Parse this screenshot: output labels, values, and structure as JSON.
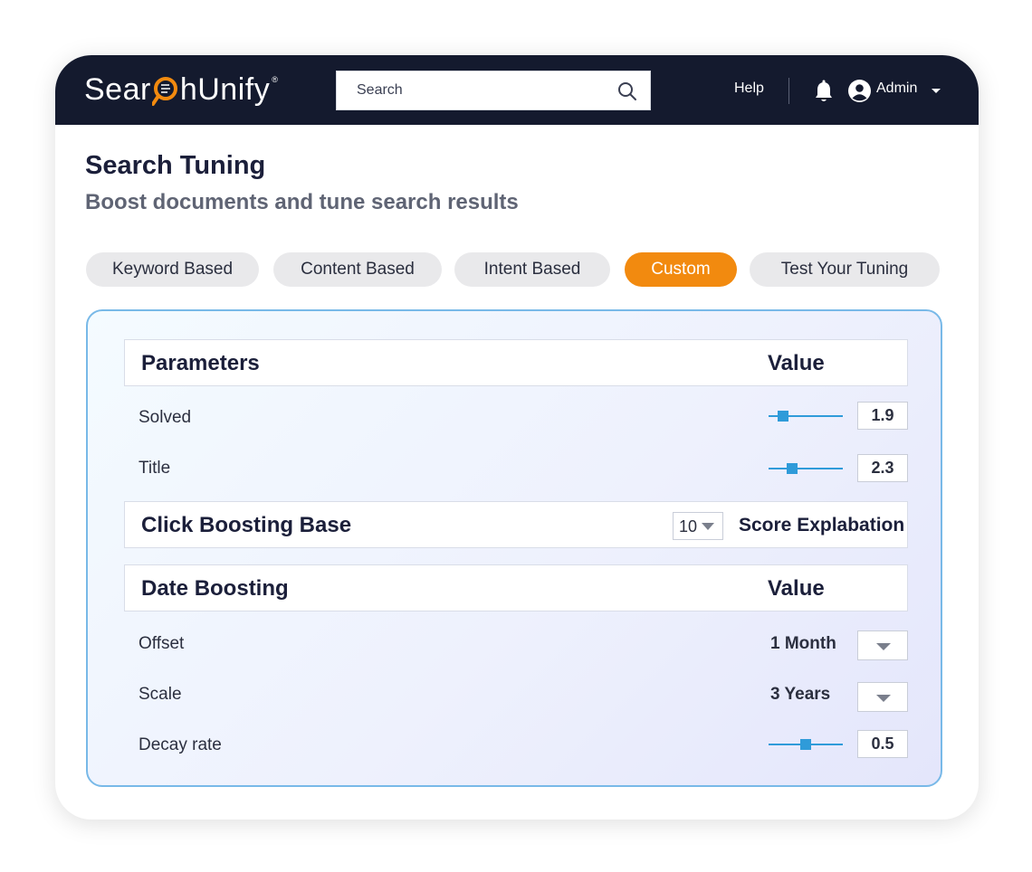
{
  "header": {
    "logo_text_left": "Sear",
    "logo_text_right": "hUnify",
    "logo_registered": "®",
    "search_placeholder": "Search",
    "help_label": "Help",
    "user_label": "Admin",
    "icons": [
      "search-icon",
      "bell-icon",
      "user-avatar-icon",
      "caret-down-icon"
    ]
  },
  "page": {
    "title": "Search Tuning",
    "subtitle": "Boost documents and tune search results"
  },
  "tabs": [
    {
      "label": "Keyword Based",
      "active": false
    },
    {
      "label": "Content Based",
      "active": false
    },
    {
      "label": "Intent Based",
      "active": false
    },
    {
      "label": "Custom",
      "active": true
    },
    {
      "label": "Test Your Tuning",
      "active": false
    }
  ],
  "parameters": {
    "header_label": "Parameters",
    "value_label": "Value",
    "rows": [
      {
        "label": "Solved",
        "value": "1.9",
        "slider_fraction": 0.2
      },
      {
        "label": "Title",
        "value": "2.3",
        "slider_fraction": 0.32
      }
    ]
  },
  "click_boosting": {
    "label": "Click Boosting Base",
    "select_value": "10",
    "score_label": "Score Explabation"
  },
  "date_boosting": {
    "header_label": "Date Boosting",
    "value_label": "Value",
    "offset": {
      "label": "Offset",
      "value": "1 Month"
    },
    "scale": {
      "label": "Scale",
      "value": "3 Years"
    },
    "decay": {
      "label": "Decay rate",
      "value": "0.5",
      "slider_fraction": 0.5
    }
  },
  "colors": {
    "topbar": "#141a2e",
    "accent": "#f28a0f",
    "slider": "#2f9bd9",
    "panel_border": "#78b9e8"
  }
}
